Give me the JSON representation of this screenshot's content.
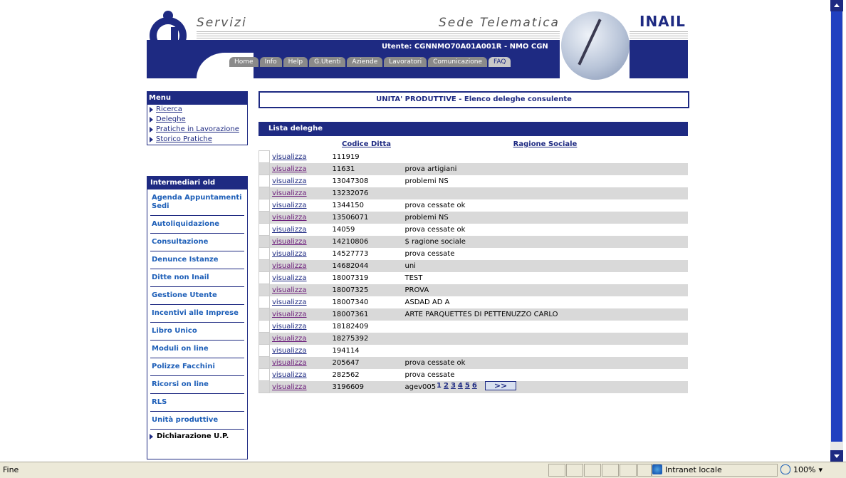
{
  "header": {
    "servizi": "Servizi",
    "sede": "Sede Telematica",
    "brand": "INAIL",
    "user": "Utente: CGNNMO70A01A001R - NMO CGN",
    "nav": [
      "Home",
      "Info",
      "Help",
      "G.Utenti",
      "Aziende",
      "Lavoratori",
      "Comunicazione",
      "FAQ"
    ]
  },
  "menu": {
    "title": "Menu",
    "items": [
      "Ricerca",
      "Deleghe",
      "Pratiche in Lavorazione",
      "Storico Pratiche"
    ]
  },
  "intermediari": {
    "title": "Intermediari old",
    "items": [
      "Agenda Appuntamenti Sedi",
      "Autoliquidazione",
      "Consultazione",
      "Denunce Istanze",
      "Ditte non Inail",
      "Gestione Utente",
      "Incentivi alle Imprese",
      "Libro Unico",
      "Moduli on line",
      "Polizze Facchini",
      "Ricorsi on line",
      "RLS",
      "Unità produttive"
    ],
    "footer": "Dichiarazione U.P."
  },
  "main": {
    "title": "UNITA' PRODUTTIVE - Elenco deleghe consulente",
    "list_title": "Lista deleghe",
    "columns": [
      "Codice Ditta",
      "Ragione Sociale"
    ],
    "link_label": "visualizza",
    "rows": [
      {
        "code": "111919",
        "name": ""
      },
      {
        "code": "11631",
        "name": "prova artigiani"
      },
      {
        "code": "13047308",
        "name": "problemi NS"
      },
      {
        "code": "13232076",
        "name": ""
      },
      {
        "code": "1344150",
        "name": "prova cessate ok"
      },
      {
        "code": "13506071",
        "name": "problemi NS"
      },
      {
        "code": "14059",
        "name": "prova cessate ok"
      },
      {
        "code": "14210806",
        "name": "$ ragione sociale"
      },
      {
        "code": "14527773",
        "name": "prova cessate"
      },
      {
        "code": "14682044",
        "name": "uni"
      },
      {
        "code": "18007319",
        "name": "TEST"
      },
      {
        "code": "18007325",
        "name": "PROVA"
      },
      {
        "code": "18007340",
        "name": "ASDAD AD A"
      },
      {
        "code": "18007361",
        "name": "ARTE PARQUETTES DI PETTENUZZO CARLO"
      },
      {
        "code": "18182409",
        "name": ""
      },
      {
        "code": "18275392",
        "name": ""
      },
      {
        "code": "194114",
        "name": ""
      },
      {
        "code": "205647",
        "name": "prova cessate ok"
      },
      {
        "code": "282562",
        "name": "prova cessate"
      },
      {
        "code": "3196609",
        "name": "agev005"
      }
    ],
    "pager": {
      "current": "1",
      "pages": [
        "2",
        "3",
        "4",
        "5",
        "6"
      ],
      "next": ">>"
    }
  },
  "status": {
    "text": "Fine",
    "zone": "Intranet locale",
    "zoom": "100%"
  }
}
